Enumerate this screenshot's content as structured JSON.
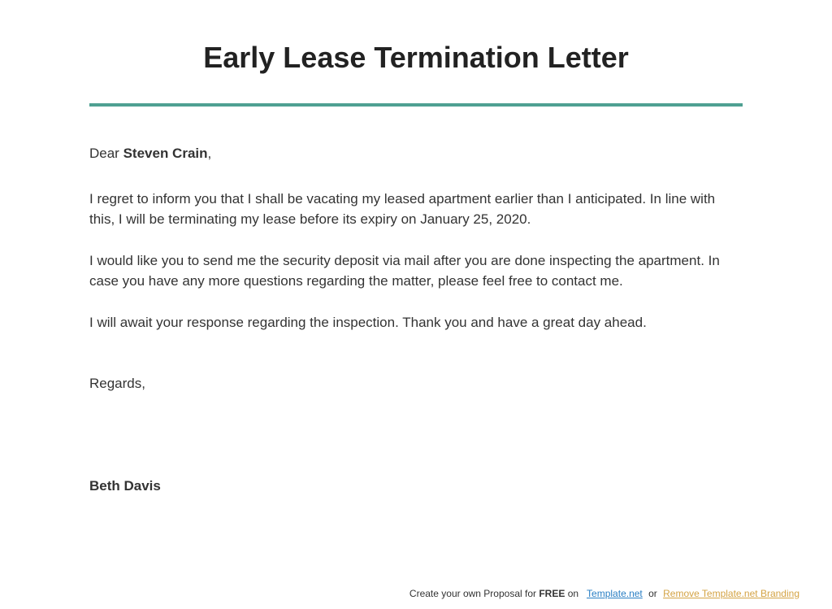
{
  "title": "Early Lease Termination Letter",
  "salutation": {
    "greeting": "Dear ",
    "name": "Steven Crain",
    "comma": ","
  },
  "paragraphs": {
    "p1": "I regret to inform you that I shall be vacating my leased apartment earlier than I anticipated. In line with this, I will be terminating my lease before its expiry on January 25, 2020.",
    "p2": "I would like you to send me the security deposit via mail after you are done inspecting the apartment. In case you have any more questions regarding the matter, please feel free to contact me.",
    "p3": "I will await your response regarding the inspection. Thank you and have a great day ahead."
  },
  "closing": "Regards,",
  "signature": "Beth Davis",
  "footer": {
    "prefix": "Create your own Proposal for ",
    "free": "FREE",
    "on": " on",
    "link1": "Template.net",
    "or": " or ",
    "link2": "Remove Template.net Branding"
  }
}
